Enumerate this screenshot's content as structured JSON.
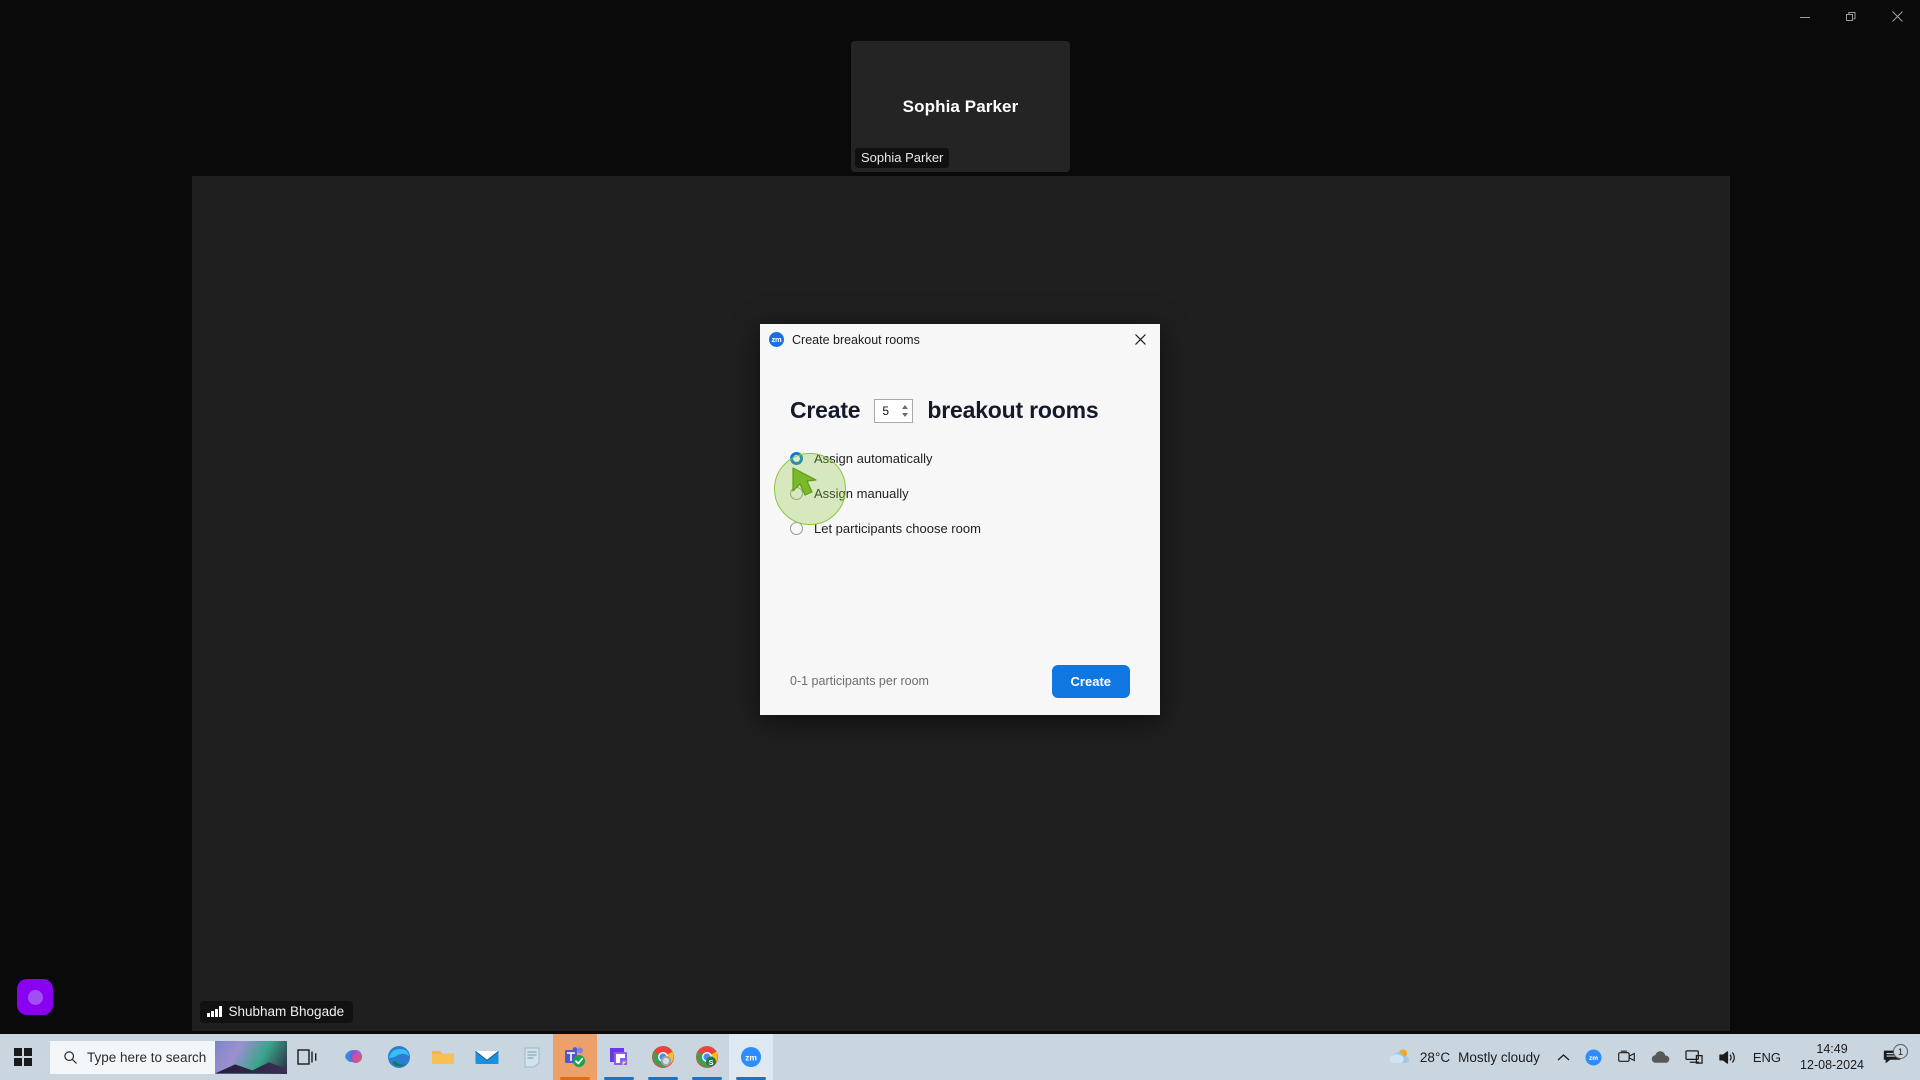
{
  "window_controls": {
    "minimize": "minimize-icon",
    "restore": "restore-icon",
    "close": "close-icon"
  },
  "meeting": {
    "participant_tile": {
      "display_name": "Sophia Parker",
      "name_badge": "Sophia Parker"
    },
    "status_chip": {
      "label": "Shubham Bhogade",
      "icon": "signal-strength-icon"
    },
    "self_thumb": "self-view-thumbnail"
  },
  "dialog": {
    "app_badge": "zm",
    "title": "Create breakout rooms",
    "close_icon": "close-icon",
    "heading": {
      "prefix": "Create",
      "count": "5",
      "suffix": "breakout rooms"
    },
    "options": [
      {
        "label": "Assign automatically",
        "selected": true
      },
      {
        "label": "Assign manually",
        "selected": false
      },
      {
        "label": "Let participants choose room",
        "selected": false
      }
    ],
    "footer": {
      "note": "0-1 participants per room",
      "create_label": "Create"
    },
    "accent_color": "#1177e0",
    "cursor_highlight_color": "#8cc63f"
  },
  "taskbar": {
    "start": "windows-start-icon",
    "search": {
      "placeholder": "Type here to search",
      "icon": "search-icon"
    },
    "task_view": "task-view-icon",
    "pinned": [
      {
        "name": "copilot",
        "active": false
      },
      {
        "name": "microsoft-edge",
        "active": false
      },
      {
        "name": "file-explorer",
        "active": false
      },
      {
        "name": "mail",
        "active": false
      },
      {
        "name": "notepad",
        "active": false
      },
      {
        "name": "microsoft-teams",
        "active": true
      },
      {
        "name": "powerpoint-like-app",
        "active": true
      },
      {
        "name": "google-chrome",
        "active": true
      },
      {
        "name": "google-chrome-secondary",
        "active": true
      },
      {
        "name": "zoom",
        "active": true
      }
    ],
    "tray": {
      "weather_temp": "28°C",
      "weather_desc": "Mostly cloudy",
      "show_hidden": "chevron-up-icon",
      "zoom_tray": "zoom-icon",
      "camera": "camera-icon",
      "onedrive": "cloud-icon",
      "network": "network-icon",
      "volume": "volume-icon",
      "language": "ENG",
      "time": "14:49",
      "date": "12-08-2024",
      "notification_count": "1"
    }
  }
}
